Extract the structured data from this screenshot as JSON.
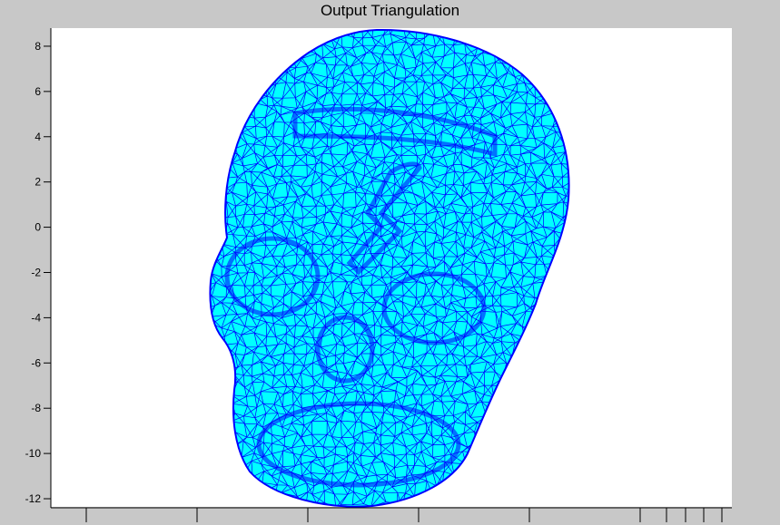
{
  "chart_data": {
    "type": "scatter",
    "title": "Output Triangulation",
    "xlabel": "",
    "ylabel": "",
    "ylim": [
      -12.4,
      8.8
    ],
    "y_ticks": [
      8,
      6,
      4,
      2,
      0,
      -2,
      -4,
      -6,
      -8,
      -10,
      -12
    ],
    "x_tick_count": 10,
    "grid": false,
    "series": [
      {
        "values": []
      }
    ],
    "colors": {
      "fill": "#00ffff",
      "edges": "#0000ff",
      "background": "#c8c8c8",
      "plot_area": "#ffffff"
    }
  }
}
